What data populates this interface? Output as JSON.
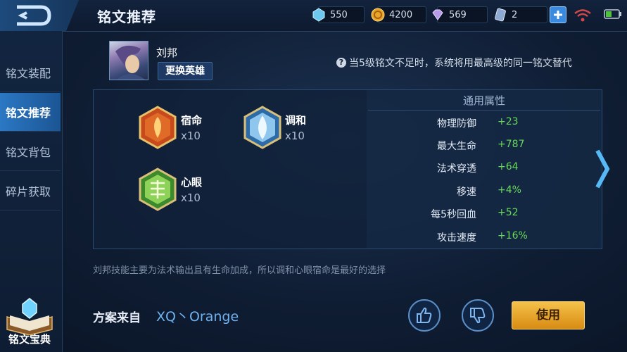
{
  "header": {
    "title": "铭文推荐",
    "resources": [
      {
        "icon": "diamond-icon",
        "value": "550"
      },
      {
        "icon": "gold-coin-icon",
        "value": "4200"
      },
      {
        "icon": "gem-icon",
        "value": "569"
      },
      {
        "icon": "ticket-icon",
        "value": "2"
      }
    ],
    "add_icon": "plus-icon",
    "signal_icon": "wifi-icon",
    "battery_icon": "battery-icon"
  },
  "sidebar": {
    "items": [
      {
        "label": "铭文装配",
        "active": false
      },
      {
        "label": "铭文推荐",
        "active": true
      },
      {
        "label": "铭文背包",
        "active": false
      },
      {
        "label": "碎片获取",
        "active": false
      }
    ],
    "codex_label": "铭文宝典"
  },
  "hero": {
    "name": "刘邦",
    "change_button": "更换英雄"
  },
  "notice": "当5级铭文不足时，系统将用最高级的同一铭文替代",
  "runes": [
    {
      "name": "宿命",
      "count": "x10",
      "color": "red"
    },
    {
      "name": "调和",
      "count": "x10",
      "color": "blue"
    },
    {
      "name": "心眼",
      "count": "x10",
      "color": "green"
    }
  ],
  "properties": {
    "title": "通用属性",
    "rows": [
      {
        "name": "物理防御",
        "value": "+23"
      },
      {
        "name": "最大生命",
        "value": "+787"
      },
      {
        "name": "法术穿透",
        "value": "+64"
      },
      {
        "name": "移速",
        "value": "+4%"
      },
      {
        "name": "每5秒回血",
        "value": "+52"
      },
      {
        "name": "攻击速度",
        "value": "+16%"
      }
    ]
  },
  "description": "刘邦技能主要为法术输出且有生命加成，所以调和心眼宿命是最好的选择",
  "plan": {
    "label": "方案来自",
    "author": "XQ丶Orange"
  },
  "actions": {
    "use_label": "使用",
    "like_icon": "thumbs-up-icon",
    "dislike_icon": "thumbs-down-icon"
  },
  "colors": {
    "accent": "#2b78c4",
    "positive": "#68da5a",
    "use_button": "#e8a42a"
  }
}
